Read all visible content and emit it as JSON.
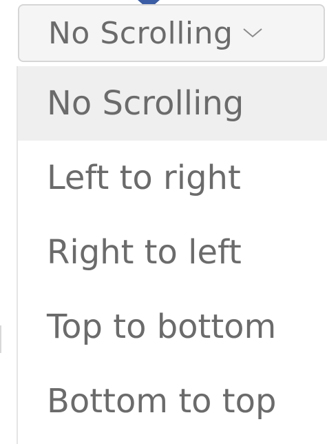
{
  "select": {
    "value": "No Scrolling",
    "chevron_icon": "chevron-down-icon"
  },
  "menu": {
    "options": [
      {
        "label": "No Scrolling",
        "selected": true
      },
      {
        "label": "Left to right",
        "selected": false
      },
      {
        "label": "Right to left",
        "selected": false
      },
      {
        "label": "Top to bottom",
        "selected": false
      },
      {
        "label": "Bottom to top",
        "selected": false
      }
    ]
  },
  "colors": {
    "text": "#6b6b6b",
    "selected_bg": "#efefef",
    "pointer": "#3b5da6"
  }
}
